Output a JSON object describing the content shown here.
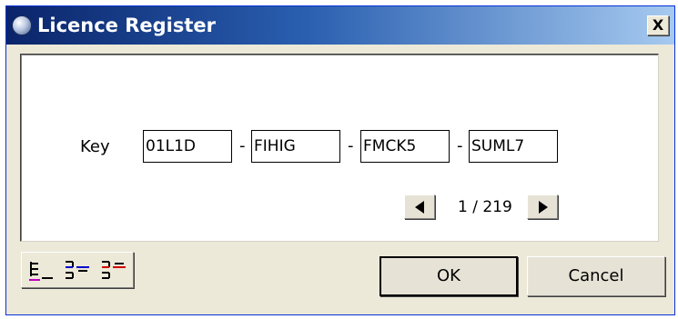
{
  "window": {
    "title": "Licence Register",
    "close_label": "X"
  },
  "key": {
    "label": "Key",
    "separator": "-",
    "segments": [
      "01L1D",
      "FIHIG",
      "FMCK5",
      "SUML7"
    ]
  },
  "pager": {
    "indicator": "1 / 219"
  },
  "toolbar": {
    "tools": [
      "align-bottom-icon",
      "align-center-icon",
      "align-top-icon"
    ]
  },
  "buttons": {
    "ok_label": "OK",
    "cancel_label": "Cancel"
  }
}
